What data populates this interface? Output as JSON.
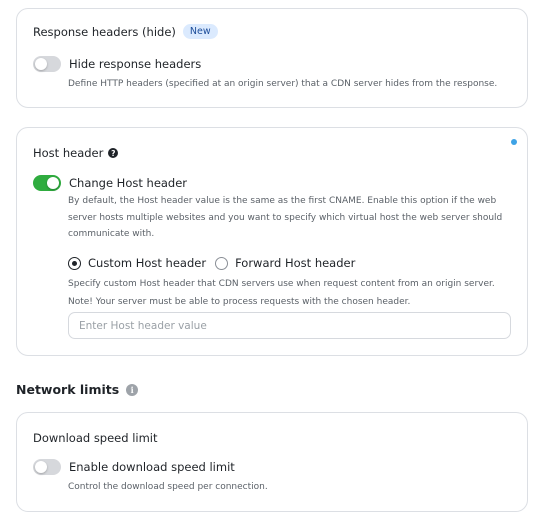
{
  "response_headers": {
    "title": "Response headers (hide)",
    "badge": "New",
    "toggle_label": "Hide response headers",
    "toggle_on": false,
    "description": "Define HTTP headers (specified at an origin server) that a CDN server hides from the response."
  },
  "host_header": {
    "title": "Host header",
    "toggle_label": "Change Host header",
    "toggle_on": true,
    "description_lines": [
      "By default, the Host header value is the same as the first CNAME. Enable this option if the web",
      "server hosts multiple websites and you want to specify which virtual host the web server should",
      "communicate with."
    ],
    "radio_options": [
      {
        "label": "Custom Host header",
        "checked": true
      },
      {
        "label": "Forward Host header",
        "checked": false
      }
    ],
    "hint_lines": [
      "Specify custom Host header that CDN servers use when request content from an origin server.",
      "Note! Your server must be able to process requests with the chosen header."
    ],
    "input_placeholder": "Enter Host header value",
    "input_value": ""
  },
  "network_limits": {
    "title": "Network limits"
  },
  "download_speed": {
    "title": "Download speed limit",
    "toggle_label": "Enable download speed limit",
    "toggle_on": false,
    "description": "Control the download speed per connection."
  },
  "icons": {
    "help": "question-circle-icon",
    "info": "info-circle-icon",
    "indicator": "status-dot-icon"
  },
  "colors": {
    "toggle_on": "#2fac3f",
    "toggle_off": "#d6d8dc",
    "badge_bg": "#dbeafe",
    "badge_text": "#1e4e9a",
    "indicator": "#3ea3e6",
    "border": "#dcdfe4"
  }
}
